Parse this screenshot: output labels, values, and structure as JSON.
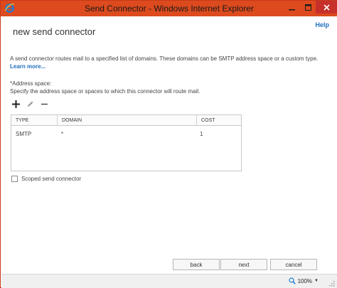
{
  "window": {
    "title": "Send Connector - Windows Internet Explorer",
    "colors": {
      "titlebar": "#dc4a1e",
      "close": "#c7302a",
      "link": "#1f6fbf"
    }
  },
  "page": {
    "help_label": "Help",
    "title": "new send connector",
    "description": "A send connector routes mail to a specified list of domains. These domains can be SMTP address space or a custom type.",
    "learn_more": "Learn more...",
    "address_space_label": "*Address space:",
    "address_space_desc": "Specify the address space or spaces to which this connector will route mail."
  },
  "toolbar": {
    "add_icon": "plus-icon",
    "edit_icon": "pencil-icon",
    "remove_icon": "minus-icon"
  },
  "grid": {
    "columns": [
      "TYPE",
      "DOMAIN",
      "COST"
    ],
    "rows": [
      {
        "type": "SMTP",
        "domain": "*",
        "cost": "1"
      }
    ]
  },
  "scoped": {
    "label": "Scoped send connector",
    "checked": false
  },
  "buttons": {
    "back": "back",
    "next": "next",
    "cancel": "cancel"
  },
  "statusbar": {
    "zoom": "100%"
  }
}
